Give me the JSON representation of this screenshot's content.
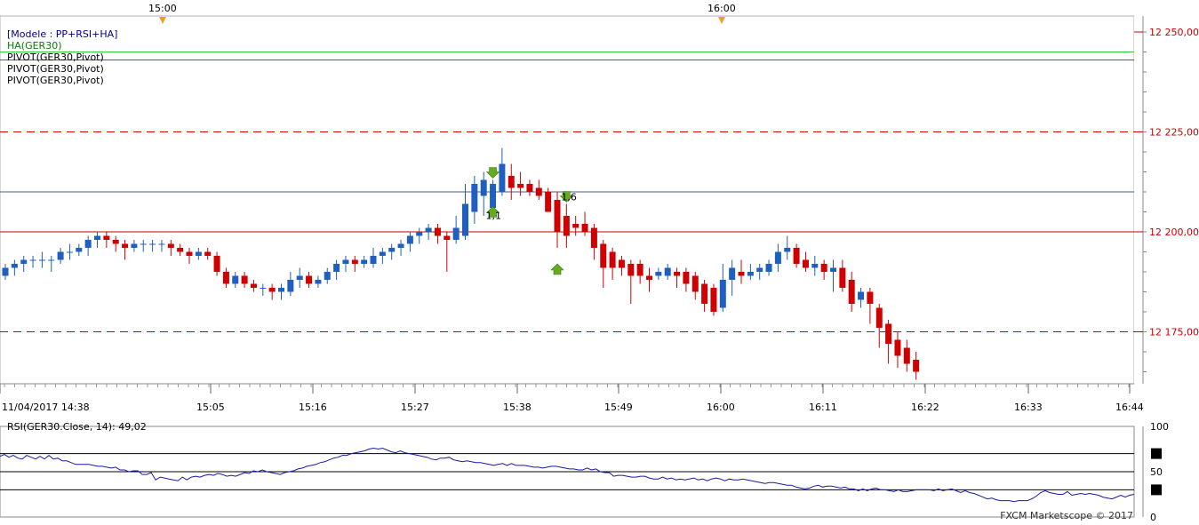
{
  "header": {
    "legend": [
      {
        "text": "[Modele : PP+RSI+HA]",
        "color": "#00008b"
      },
      {
        "text": "HA(GER30)",
        "color": "#008000"
      },
      {
        "text": "PIVOT(GER30,Pivot)",
        "color": "#000000"
      },
      {
        "text": "PIVOT(GER30,Pivot)",
        "color": "#000000"
      },
      {
        "text": "PIVOT(GER30,Pivot)",
        "color": "#000000"
      }
    ],
    "top_time_markers": [
      "15:00",
      "16:00"
    ]
  },
  "footer": {
    "credit": "FXCM Marketscope © 2017"
  },
  "rsi_panel": {
    "label": "RSI(GER30.Close, 14): 49,02",
    "ticks": [
      "100",
      "50",
      "0"
    ]
  },
  "colors": {
    "bull": "#1f5fbf",
    "bear": "#d10000",
    "pivot_red": "#cc0000",
    "pivot_blue": "#4a5a9a",
    "green_line": "#33cc33",
    "arrow": "#66aa22"
  },
  "chart_data": [
    {
      "type": "candlestick",
      "title": "",
      "xlabel": "",
      "ylabel": "",
      "x_tick_labels": [
        "11/04/2017 14:38",
        "15:05",
        "15:16",
        "15:27",
        "15:38",
        "15:49",
        "16:00",
        "16:11",
        "16:22",
        "16:33",
        "16:44"
      ],
      "y_tick_labels": [
        "12 250,00",
        "12 225,00",
        "12 200,00",
        "12 175,00"
      ],
      "ylim": [
        12162,
        12254
      ],
      "horizontal_lines": [
        {
          "y": 12225,
          "style": "dashed",
          "color": "#cc0000"
        },
        {
          "y": 12200,
          "style": "solid",
          "color": "#cc0000"
        },
        {
          "y": 12175,
          "style": "dashed",
          "color": "#cc0000"
        },
        {
          "y": 12210,
          "style": "solid",
          "color": "#4a5a9a"
        },
        {
          "y": 12245,
          "style": "solid",
          "color": "#33cc33"
        },
        {
          "y": 12243,
          "style": "solid",
          "color": "#4a5a9a"
        }
      ],
      "annotations": [
        {
          "text": "1,1",
          "candle": 53
        },
        {
          "text": "1,6",
          "candle": 61
        }
      ],
      "signals": [
        {
          "candle": 53,
          "dir": "down"
        },
        {
          "candle": 53,
          "dir": "up"
        },
        {
          "candle": 61,
          "dir": "down"
        },
        {
          "candle": 60,
          "dir": "up"
        }
      ],
      "candles": [
        [
          12189,
          12192,
          12188,
          12191
        ],
        [
          12191,
          12193,
          12189,
          12192
        ],
        [
          12192,
          12194,
          12190,
          12193
        ],
        [
          12193,
          12194,
          12191,
          12193
        ],
        [
          12193,
          12195,
          12191,
          12193
        ],
        [
          12193,
          12194,
          12190,
          12193
        ],
        [
          12193,
          12196,
          12192,
          12195
        ],
        [
          12195,
          12197,
          12193,
          12195
        ],
        [
          12195,
          12197,
          12194,
          12196
        ],
        [
          12196,
          12199,
          12194,
          12198
        ],
        [
          12198,
          12200,
          12196,
          12199
        ],
        [
          12199,
          12200,
          12196,
          12198
        ],
        [
          12198,
          12199,
          12195,
          12197
        ],
        [
          12197,
          12198,
          12193,
          12196
        ],
        [
          12196,
          12198,
          12195,
          12197
        ],
        [
          12197,
          12198,
          12195,
          12197
        ],
        [
          12197,
          12198,
          12195,
          12197
        ],
        [
          12197,
          12198,
          12195,
          12197
        ],
        [
          12197,
          12198,
          12194,
          12196
        ],
        [
          12196,
          12197,
          12194,
          12195
        ],
        [
          12195,
          12196,
          12192,
          12194
        ],
        [
          12194,
          12196,
          12193,
          12195
        ],
        [
          12195,
          12196,
          12193,
          12194
        ],
        [
          12194,
          12195,
          12189,
          12190
        ],
        [
          12190,
          12191,
          12186,
          12187
        ],
        [
          12187,
          12190,
          12186,
          12189
        ],
        [
          12189,
          12190,
          12186,
          12187
        ],
        [
          12187,
          12188,
          12185,
          12186
        ],
        [
          12186,
          12187,
          12184,
          12186
        ],
        [
          12186,
          12187,
          12183,
          12185
        ],
        [
          12185,
          12187,
          12183,
          12186
        ],
        [
          12185,
          12190,
          12184,
          12188
        ],
        [
          12188,
          12191,
          12186,
          12189
        ],
        [
          12189,
          12190,
          12186,
          12187
        ],
        [
          12187,
          12189,
          12186,
          12188
        ],
        [
          12188,
          12191,
          12187,
          12190
        ],
        [
          12190,
          12193,
          12188,
          12192
        ],
        [
          12192,
          12194,
          12190,
          12193
        ],
        [
          12193,
          12194,
          12190,
          12192
        ],
        [
          12192,
          12194,
          12191,
          12193
        ],
        [
          12192,
          12196,
          12191,
          12194
        ],
        [
          12194,
          12196,
          12192,
          12195
        ],
        [
          12195,
          12197,
          12193,
          12196
        ],
        [
          12196,
          12198,
          12194,
          12197
        ],
        [
          12197,
          12200,
          12195,
          12199
        ],
        [
          12199,
          12201,
          12197,
          12200
        ],
        [
          12200,
          12202,
          12198,
          12201
        ],
        [
          12201,
          12202,
          12197,
          12199
        ],
        [
          12199,
          12200,
          12190,
          12198
        ],
        [
          12198,
          12204,
          12197,
          12201
        ],
        [
          12199,
          12212,
          12198,
          12207
        ],
        [
          12205,
          12214,
          12202,
          12212
        ],
        [
          12209,
          12215,
          12204,
          12213
        ],
        [
          12206,
          12213,
          12205,
          12212
        ],
        [
          12210,
          12221,
          12209,
          12217
        ],
        [
          12214,
          12217,
          12208,
          12211
        ],
        [
          12212,
          12215,
          12209,
          12211
        ],
        [
          12212,
          12213,
          12209,
          12210
        ],
        [
          12211,
          12213,
          12208,
          12209
        ],
        [
          12210,
          12211,
          12206,
          12205
        ],
        [
          12208,
          12210,
          12196,
          12200
        ],
        [
          12204,
          12207,
          12196,
          12199
        ],
        [
          12202,
          12204,
          12199,
          12201
        ],
        [
          12202,
          12205,
          12199,
          12200
        ],
        [
          12201,
          12202,
          12193,
          12196
        ],
        [
          12197,
          12198,
          12186,
          12191
        ],
        [
          12195,
          12196,
          12188,
          12191
        ],
        [
          12193,
          12194,
          12189,
          12191
        ],
        [
          12192,
          12193,
          12182,
          12189
        ],
        [
          12192,
          12193,
          12187,
          12189
        ],
        [
          12189,
          12191,
          12185,
          12188
        ],
        [
          12189,
          12191,
          12188,
          12190
        ],
        [
          12189,
          12192,
          12188,
          12191
        ],
        [
          12190,
          12191,
          12186,
          12189
        ],
        [
          12190,
          12191,
          12185,
          12187
        ],
        [
          12189,
          12190,
          12183,
          12185
        ],
        [
          12187,
          12188,
          12180,
          12182
        ],
        [
          12186,
          12187,
          12179,
          12180
        ],
        [
          12181,
          12192,
          12180,
          12188
        ],
        [
          12188,
          12193,
          12184,
          12191
        ],
        [
          12190,
          12193,
          12187,
          12189
        ],
        [
          12189,
          12192,
          12188,
          12190
        ],
        [
          12190,
          12192,
          12188,
          12191
        ],
        [
          12190,
          12193,
          12189,
          12192
        ],
        [
          12192,
          12197,
          12190,
          12195
        ],
        [
          12195,
          12199,
          12193,
          12196
        ],
        [
          12196,
          12197,
          12191,
          12192
        ],
        [
          12193,
          12195,
          12190,
          12191
        ],
        [
          12191,
          12194,
          12189,
          12192
        ],
        [
          12192,
          12193,
          12188,
          12190
        ],
        [
          12190,
          12193,
          12185,
          12191
        ],
        [
          12191,
          12193,
          12185,
          12186
        ],
        [
          12188,
          12190,
          12180,
          12182
        ],
        [
          12183,
          12186,
          12181,
          12185
        ],
        [
          12185,
          12186,
          12177,
          12182
        ],
        [
          12181,
          12182,
          12171,
          12176
        ],
        [
          12177,
          12178,
          12167,
          12172
        ],
        [
          12173,
          12175,
          12166,
          12169
        ],
        [
          12171,
          12173,
          12165,
          12167
        ],
        [
          12168,
          12170,
          12163,
          12165
        ]
      ]
    },
    {
      "type": "line",
      "title": "",
      "series": [
        {
          "values": [
            67,
            69,
            66,
            68,
            65,
            64,
            68,
            66,
            64,
            67,
            64,
            68,
            64,
            65,
            62,
            62,
            60,
            58,
            58,
            58,
            58,
            57,
            56,
            56,
            55,
            54,
            55,
            52,
            52,
            50,
            51,
            51,
            47,
            47,
            49,
            41,
            44,
            43,
            42,
            41,
            40,
            44,
            41,
            44,
            45,
            44,
            46,
            47,
            46,
            48,
            47,
            45,
            46,
            45,
            47,
            49,
            48,
            51,
            50,
            52,
            50,
            49,
            48,
            47,
            49,
            50,
            51,
            53,
            54,
            56,
            57,
            58,
            60,
            61,
            63,
            65,
            66,
            68,
            68,
            70,
            71,
            72,
            73,
            75,
            76,
            75,
            76,
            74,
            72,
            71,
            73,
            71,
            70,
            69,
            68,
            67,
            66,
            64,
            63,
            65,
            65,
            66,
            63,
            62,
            61,
            62,
            61,
            60,
            60,
            59,
            58,
            57,
            58,
            59,
            57,
            59,
            57,
            57,
            57,
            56,
            55,
            55,
            54,
            55,
            56,
            56,
            55,
            54,
            53,
            53,
            52,
            52,
            54,
            52,
            53,
            50,
            49,
            49,
            45,
            46,
            46,
            45,
            44,
            44,
            45,
            45,
            43,
            42,
            42,
            44,
            42,
            43,
            41,
            42,
            41,
            42,
            43,
            41,
            42,
            40,
            42,
            43,
            42,
            40,
            42,
            41,
            41,
            42,
            41,
            40,
            39,
            38,
            37,
            38,
            38,
            37,
            36,
            35,
            35,
            33,
            32,
            31,
            32,
            34,
            35,
            33,
            34,
            34,
            33,
            32,
            33,
            31,
            31,
            29,
            31,
            29,
            31,
            32,
            30,
            30,
            29,
            28,
            30,
            28,
            28,
            29,
            30,
            30,
            30,
            30,
            29,
            31,
            29,
            30,
            31,
            29,
            27,
            29,
            27,
            26,
            24,
            22,
            20,
            21,
            19,
            18,
            18,
            18,
            17,
            18,
            18,
            18,
            20,
            23,
            27,
            29,
            27,
            26,
            25,
            25,
            28,
            24,
            25,
            26,
            25,
            26,
            25,
            24,
            22,
            21,
            20,
            22,
            24,
            22,
            24,
            25
          ]
        }
      ],
      "ylim": [
        0,
        100
      ],
      "levels": [
        70,
        50,
        30
      ],
      "y_tick_labels": [
        "100",
        "50",
        "0"
      ]
    }
  ]
}
